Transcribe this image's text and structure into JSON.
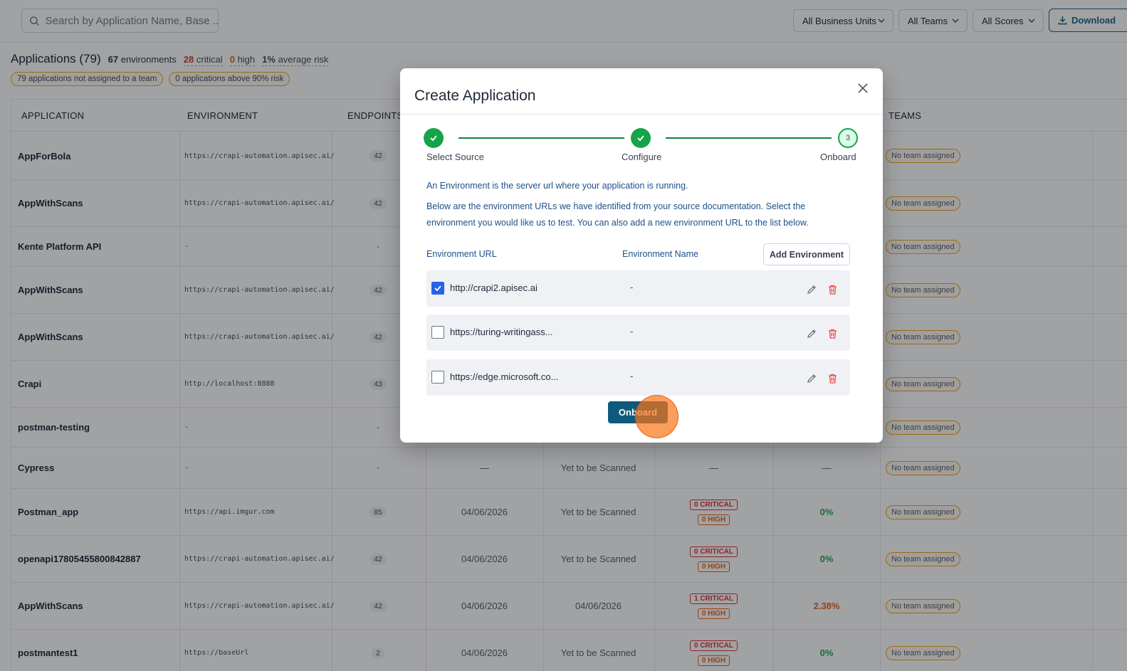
{
  "search": {
    "placeholder": "Search by Application Name, Base ..."
  },
  "filters": [
    "All Business Units",
    "All Teams",
    "All Scores"
  ],
  "download_label": "Download",
  "summary": {
    "title": "Applications (79)",
    "env_count": "67",
    "env_label": "environments",
    "critical_count": "28",
    "critical_label": "critical",
    "high_count": "0",
    "high_label": "high",
    "risk_value": "1%",
    "risk_label": "average risk",
    "chip_unassigned": "79 applications not assigned to a team",
    "chip_above": "0 applications above 90% risk"
  },
  "table": {
    "headers": {
      "application": "APPLICATION",
      "environment": "ENVIRONMENT",
      "endpoints": "ENDPOINTS",
      "teams": "TEAMS"
    },
    "rows": [
      {
        "app": "AppForBola",
        "env": "https://crapi-automation.apisec.ai/",
        "endpoints": "42",
        "date1": "",
        "date2": "",
        "critical": "",
        "high": "",
        "risk": "",
        "team": "No team assigned"
      },
      {
        "app": "AppWithScans",
        "env": "https://crapi-automation.apisec.ai/",
        "endpoints": "42",
        "date1": "",
        "date2": "",
        "critical": "",
        "high": "",
        "risk": "",
        "team": "No team assigned"
      },
      {
        "app": "Kente Platform API",
        "env": "-",
        "endpoints": "-",
        "date1": "",
        "date2": "",
        "critical": "",
        "high": "",
        "risk": "",
        "team": "No team assigned"
      },
      {
        "app": "AppWithScans",
        "env": "https://crapi-automation.apisec.ai/",
        "endpoints": "42",
        "date1": "",
        "date2": "",
        "critical": "",
        "high": "",
        "risk": "",
        "team": "No team assigned"
      },
      {
        "app": "AppWithScans",
        "env": "https://crapi-automation.apisec.ai/",
        "endpoints": "42",
        "date1": "",
        "date2": "",
        "critical": "",
        "high": "",
        "risk": "",
        "team": "No team assigned"
      },
      {
        "app": "Crapi",
        "env": "http://localhost:8888",
        "endpoints": "43",
        "date1": "",
        "date2": "",
        "critical": "",
        "high": "",
        "risk": "",
        "team": "No team assigned"
      },
      {
        "app": "postman-testing",
        "env": "-",
        "endpoints": "-",
        "date1": "",
        "date2": "",
        "critical": "",
        "high": "",
        "risk": "",
        "team": "No team assigned"
      },
      {
        "app": "Cypress",
        "env": "-",
        "endpoints": "-",
        "date1": "—",
        "date2": "Yet to be Scanned",
        "critical": "",
        "high": "",
        "sev_dash": "—",
        "risk": "—",
        "team": "No team assigned"
      },
      {
        "app": "Postman_app",
        "env": "https://api.imgur.com",
        "endpoints": "85",
        "date1": "04/06/2026",
        "date2": "Yet to be Scanned",
        "critical": "0 CRITICAL",
        "high": "0 HIGH",
        "risk": "0%",
        "team": "No team assigned"
      },
      {
        "app": "openapi17805455800842887",
        "env": "https://crapi-automation.apisec.ai/",
        "endpoints": "42",
        "date1": "04/06/2026",
        "date2": "Yet to be Scanned",
        "critical": "0 CRITICAL",
        "high": "0 HIGH",
        "risk": "0%",
        "team": "No team assigned"
      },
      {
        "app": "AppWithScans",
        "env": "https://crapi-automation.apisec.ai/",
        "endpoints": "42",
        "date1": "04/06/2026",
        "date2": "04/06/2026",
        "critical": "1 CRITICAL",
        "high": "0 HIGH",
        "risk": "2.38%",
        "team": "No team assigned"
      },
      {
        "app": "postmantest1",
        "env": "https://baseUrl",
        "endpoints": "2",
        "date1": "04/06/2026",
        "date2": "Yet to be Scanned",
        "critical": "0 CRITICAL",
        "high": "0 HIGH",
        "risk": "0%",
        "team": "No team assigned"
      }
    ]
  },
  "modal": {
    "title": "Create Application",
    "steps": [
      {
        "label": "Select Source",
        "state": "done"
      },
      {
        "label": "Configure",
        "state": "done"
      },
      {
        "label": "Onboard",
        "state": "current",
        "number": "3"
      }
    ],
    "info_line1": "An Environment is the server url where your application is running.",
    "info_line2": "Below are the environment URLs we have identified from your source documentation. Select the",
    "info_line3": "environment you would like us to test. You can also add a new environment URL to the list below.",
    "col_url": "Environment URL",
    "col_name": "Environment Name",
    "add_env_label": "Add Environment",
    "environments": [
      {
        "url": "http://crapi2.apisec.ai",
        "name": "-",
        "checked": true
      },
      {
        "url": "https://turing-writingass...",
        "name": "-",
        "checked": false
      },
      {
        "url": "https://edge.microsoft.co...",
        "name": "-",
        "checked": false
      }
    ],
    "onboard_label": "Onboard"
  },
  "colors": {
    "accent": "#0e5a7a",
    "success": "#16a34a",
    "critical": "#dc2626",
    "high": "#ea580c",
    "checkbox": "#2563eb"
  }
}
